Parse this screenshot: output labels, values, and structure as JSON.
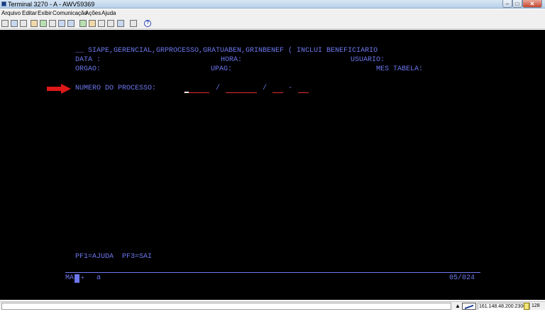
{
  "window": {
    "title": "Terminal 3270 - A - AWV59369",
    "controls": {
      "minimize": "–",
      "maximize": "□",
      "close": "✕"
    }
  },
  "menu": [
    "Arquivo",
    "Editar",
    "Exibir",
    "Comunicação",
    "Ações",
    "Ajuda"
  ],
  "toolbar": {
    "icons": [
      "print-icon",
      "copy-icon",
      "paste-icon",
      "cut-icon",
      "select-icon",
      "options-icon",
      "keyboard-icon",
      "macro-icon",
      "transfer-icon",
      "record-icon",
      "play-icon",
      "stop-icon",
      "send-icon",
      "receive-icon",
      "settings-icon",
      "help-icon"
    ],
    "help_glyph": "?"
  },
  "screen": {
    "header_line1": "__ SIAPE,GERENCIAL,GRPROCESSO,GRATUABEN,GRINBENEF ( INCLUI BENEFICIARIO",
    "data_label": "DATA :",
    "hora_label": "HORA:",
    "usuario_label": "USUARIO:",
    "orgao_label": "ORGAO:",
    "upag_label": "UPAG:",
    "mes_tabela_label": "MES TABELA:",
    "processo_label": "NUMERO DO PROCESSO:",
    "sep1": "/",
    "sep2": "/",
    "sep3": "-",
    "pf_keys": "PF1=AJUDA  PF3=SAI",
    "oia_mode": "MA",
    "oia_plus": "+",
    "oia_a": "a",
    "cursor_pos": "05/024",
    "accent_color": "#6e78f0",
    "field_color": "#e03030",
    "arrow_color": "#e01818"
  },
  "status": {
    "host": "161.148.48.200:23000",
    "sessions": "128"
  }
}
